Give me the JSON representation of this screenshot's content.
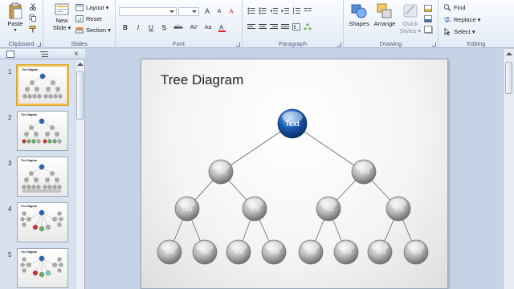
{
  "ribbon": {
    "clipboard": {
      "label": "Clipboard",
      "paste": "Paste"
    },
    "slides": {
      "label": "Slides",
      "new_slide": "New",
      "new_slide2": "Slide ▾",
      "layout": "Layout ▾",
      "reset": "Reset",
      "section": "Section ▾"
    },
    "font": {
      "label": "Font",
      "bold": "B",
      "italic": "I",
      "underline": "U",
      "strike": "S",
      "shadow": "abc",
      "spacing": "AV",
      "case": "Aa",
      "grow": "A",
      "shrink": "A",
      "clear": "A"
    },
    "paragraph": {
      "label": "Paragraph"
    },
    "drawing": {
      "label": "Drawing",
      "shapes": "Shapes",
      "arrange": "Arrange",
      "quick_styles": "Quick",
      "quick_styles2": "Styles ▾"
    },
    "editing": {
      "label": "Editing",
      "find": "Find",
      "replace": "Replace ▾",
      "select": "Select ▾"
    }
  },
  "thumbnails": [
    {
      "num": "1",
      "title": "Tree Diagram",
      "selected": true
    },
    {
      "num": "2",
      "title": "Tree Diagram",
      "selected": false
    },
    {
      "num": "3",
      "title": "Tree Diagram",
      "selected": false
    },
    {
      "num": "4",
      "title": "Tree Diagram",
      "selected": false
    },
    {
      "num": "5",
      "title": "Tree Diagram",
      "selected": false
    }
  ],
  "slide": {
    "title": "Tree Diagram",
    "root_label": "Text",
    "node_label": "Text"
  },
  "colors": {
    "root": "#1f5fb5",
    "node": "#b8b8b8",
    "selection": "#f2c44f"
  }
}
